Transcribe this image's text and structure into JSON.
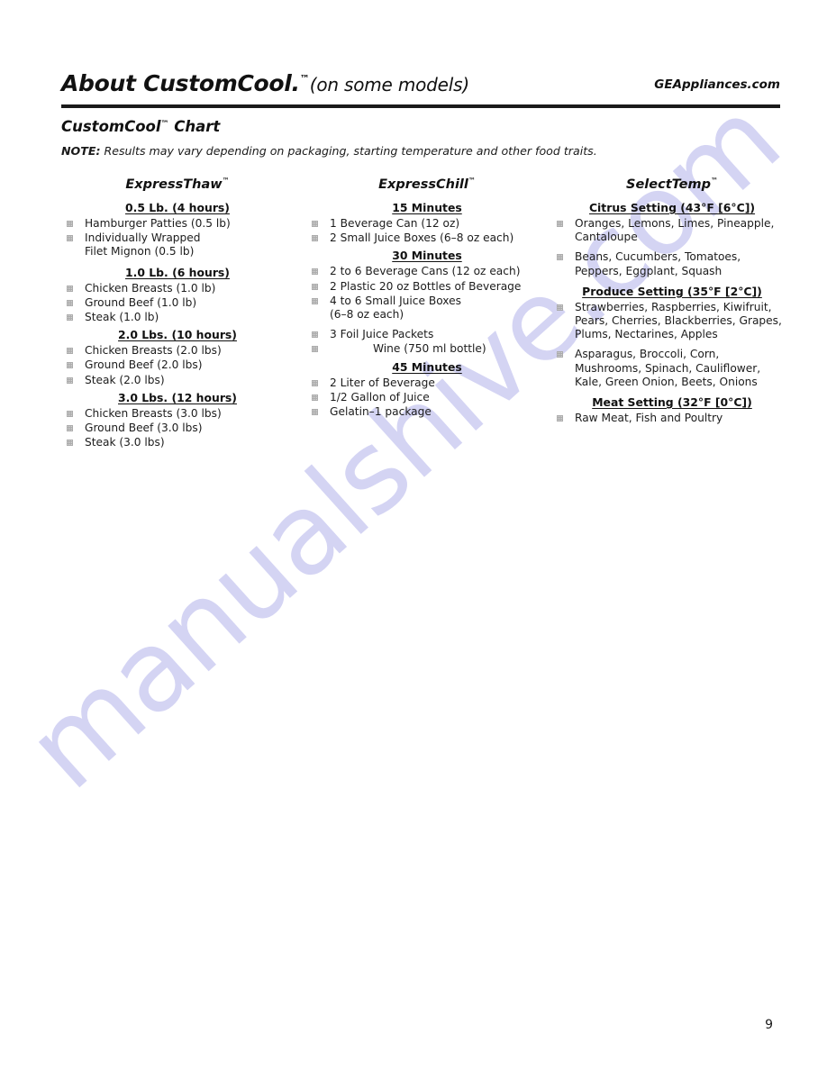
{
  "header": {
    "title_main": "About CustomCool.",
    "title_tm": "™",
    "title_sub": "(on some models)",
    "site_url": "GEAppliances.com"
  },
  "chart": {
    "title_main": "CustomCool",
    "title_tm": "™",
    "title_suffix": " Chart",
    "note_label": "NOTE:",
    "note_text": " Results may vary depending on packaging, starting temperature and other food traits."
  },
  "columns": [
    {
      "id": "expressthaw",
      "title": "ExpressThaw",
      "title_tm": "™",
      "groups": [
        {
          "heading": "0.5 Lb. (4 hours)",
          "items": [
            "Hamburger Patties (0.5 lb)",
            "Individually Wrapped\nFilet Mignon (0.5 lb)"
          ]
        },
        {
          "heading": "1.0 Lb. (6 hours)",
          "items": [
            "Chicken Breasts (1.0 lb)",
            "Ground Beef (1.0 lb)",
            "Steak (1.0 lb)"
          ]
        },
        {
          "heading": "2.0 Lbs. (10 hours)",
          "items": [
            "Chicken Breasts (2.0 lbs)",
            "Ground Beef (2.0 lbs)",
            "Steak (2.0 lbs)"
          ]
        },
        {
          "heading": "3.0 Lbs. (12 hours)",
          "items": [
            "Chicken Breasts (3.0 lbs)",
            "Ground Beef (3.0 lbs)",
            "Steak (3.0 lbs)"
          ]
        }
      ]
    },
    {
      "id": "expresschill",
      "title": "ExpressChill",
      "title_tm": "™",
      "groups": [
        {
          "heading": "15 Minutes",
          "items": [
            "1 Beverage Can (12 oz)",
            "2 Small Juice Boxes (6–8 oz each)"
          ]
        },
        {
          "heading": "30 Minutes",
          "items": [
            "2 to 6 Beverage Cans (12 oz each)",
            "2 Plastic 20 oz Bottles of Beverage",
            "4 to 6 Small Juice Boxes\n(6–8 oz each)",
            "3 Foil Juice Packets",
            "Wine (750 ml bottle)"
          ]
        },
        {
          "heading": "45 Minutes",
          "items": [
            "2 Liter of Beverage",
            "1/2 Gallon of Juice",
            "Gelatin–1 package"
          ]
        }
      ]
    },
    {
      "id": "selecttemp",
      "title": "SelectTemp",
      "title_tm": "™",
      "groups": [
        {
          "heading": "Citrus Setting (43°F [6°C])",
          "items": [
            "Oranges, Lemons, Limes, Pineapple,\nCantaloupe",
            "Beans, Cucumbers, Tomatoes,\nPeppers, Eggplant, Squash"
          ]
        },
        {
          "heading": "Produce Setting (35°F [2°C])",
          "items": [
            "Strawberries, Raspberries, Kiwifruit,\nPears, Cherries, Blackberries, Grapes,\nPlums, Nectarines, Apples",
            "Asparagus, Broccoli, Corn,\nMushrooms, Spinach, Cauliflower,\nKale, Green Onion, Beets, Onions"
          ]
        },
        {
          "heading": "Meat Setting (32°F [0°C])",
          "items": [
            "Raw Meat, Fish and Poultry"
          ]
        }
      ]
    }
  ],
  "footer": {
    "page_number": "9"
  },
  "watermark": {
    "text": "manualshive.com",
    "color": "#cdcdf2"
  }
}
